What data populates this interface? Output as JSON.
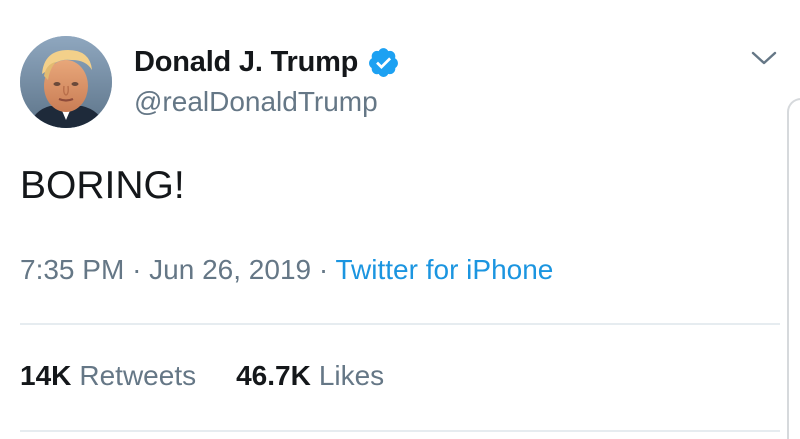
{
  "author": {
    "display_name": "Donald J. Trump",
    "handle": "@realDonaldTrump",
    "verified": true
  },
  "tweet": {
    "text": "BORING!"
  },
  "meta": {
    "time": "7:35 PM",
    "separator": "·",
    "date": "Jun 26, 2019",
    "source": "Twitter for iPhone"
  },
  "stats": {
    "retweets_count": "14K",
    "retweets_label": "Retweets",
    "likes_count": "46.7K",
    "likes_label": "Likes"
  },
  "icons": {
    "verified": "verified-badge-icon",
    "menu": "chevron-down-icon"
  },
  "colors": {
    "text_primary": "#14171a",
    "text_secondary": "#657786",
    "link": "#1b95e0",
    "verified": "#1da1f2",
    "divider": "#e6ecf0"
  }
}
